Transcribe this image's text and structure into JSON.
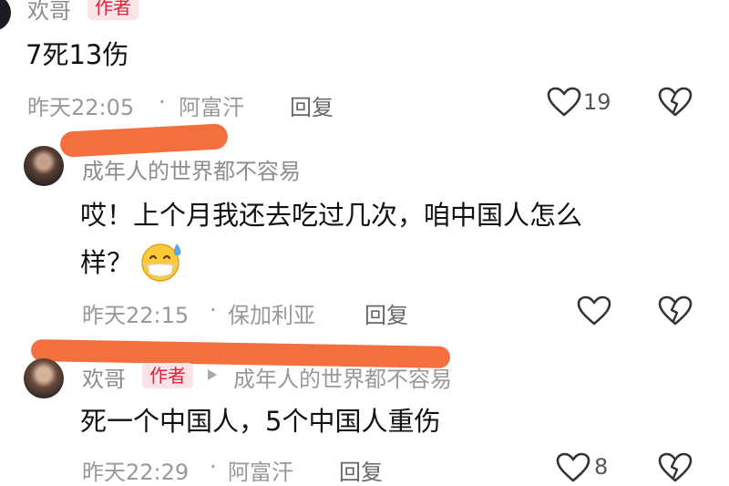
{
  "comments": [
    {
      "username": "欢哥",
      "badge": "作者",
      "text": "7死13伤",
      "time": "昨天22:05",
      "location": "阿富汗",
      "reply_label": "回复",
      "likes": "19"
    },
    {
      "username": "成年人的世界都不容易",
      "text_line1": "哎！上个月我还去吃过几次，咱中国人怎么",
      "text_line2": "样？",
      "emoji": "grinning-sweat-mask-face-emoji",
      "time": "昨天22:15",
      "location": "保加利亚",
      "reply_label": "回复"
    },
    {
      "username": "欢哥",
      "badge": "作者",
      "reply_to": "成年人的世界都不容易",
      "text": "死一个中国人，5个中国人重伤",
      "time": "昨天22:29",
      "location": "阿富汗",
      "reply_label": "回复",
      "likes": "8"
    }
  ],
  "separator": "·",
  "icons": [
    "heart-outline-icon",
    "broken-heart-icon",
    "reply-arrow-icon"
  ],
  "colors": {
    "badge_bg": "#fbe3e6",
    "badge_text": "#e0233f",
    "redaction": "#f3703e"
  }
}
